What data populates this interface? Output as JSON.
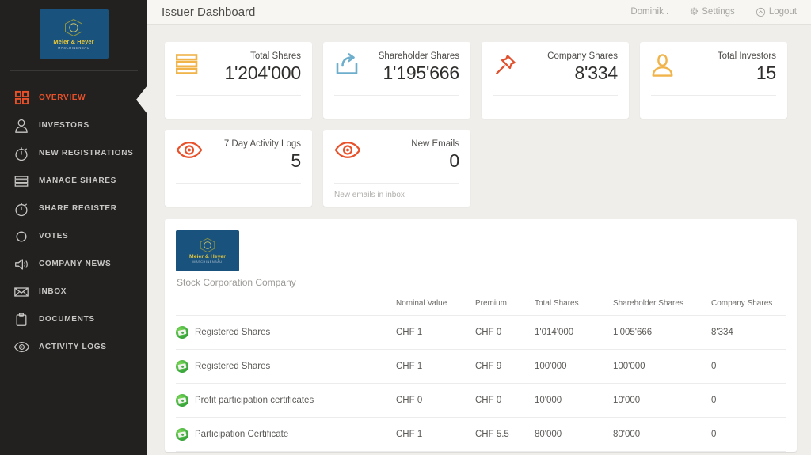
{
  "brand": {
    "name": "Meier & Heyer",
    "subtitle": "MASCHINENBAU",
    "logo_bg": "#19527c",
    "logo_text_color": "#e8c83c"
  },
  "sidebar": {
    "accent": "#e8512a",
    "bg": "#222120",
    "items": [
      {
        "label": "OVERVIEW",
        "icon": "grid-icon",
        "active": true
      },
      {
        "label": "INVESTORS",
        "icon": "user-icon",
        "active": false
      },
      {
        "label": "NEW REGISTRATIONS",
        "icon": "stopwatch-icon",
        "active": false
      },
      {
        "label": "MANAGE SHARES",
        "icon": "stack-icon",
        "active": false
      },
      {
        "label": "SHARE REGISTER",
        "icon": "stopwatch-icon",
        "active": false
      },
      {
        "label": "VOTES",
        "icon": "circle-icon",
        "active": false
      },
      {
        "label": "COMPANY NEWS",
        "icon": "megaphone-icon",
        "active": false
      },
      {
        "label": "INBOX",
        "icon": "envelope-icon",
        "active": false
      },
      {
        "label": "DOCUMENTS",
        "icon": "clipboard-icon",
        "active": false
      },
      {
        "label": "ACTIVITY LOGS",
        "icon": "eye-icon",
        "active": false
      }
    ]
  },
  "topbar": {
    "title": "Issuer Dashboard",
    "user": "Dominik .",
    "settings": "Settings",
    "logout": "Logout"
  },
  "cards": [
    {
      "label": "Total Shares",
      "value": "1'204'000",
      "icon": "bars-icon",
      "color": "#f0b44a",
      "footer": ""
    },
    {
      "label": "Shareholder Shares",
      "value": "1'195'666",
      "icon": "share-icon",
      "color": "#6eaecd",
      "footer": ""
    },
    {
      "label": "Company Shares",
      "value": "8'334",
      "icon": "pin-icon",
      "color": "#e0522f",
      "footer": ""
    },
    {
      "label": "Total Investors",
      "value": "15",
      "icon": "person-icon",
      "color": "#f0b44a",
      "footer": ""
    },
    {
      "label": "7 Day Activity Logs",
      "value": "5",
      "icon": "eye-icon",
      "color": "#e8512a",
      "footer": ""
    },
    {
      "label": "New Emails",
      "value": "0",
      "icon": "eye-icon",
      "color": "#e8512a",
      "footer": "New emails in inbox"
    }
  ],
  "panel": {
    "company_type": "Stock Corporation Company",
    "table": {
      "headers": [
        "",
        "Nominal Value",
        "Premium",
        "Total Shares",
        "Shareholder Shares",
        "Company Shares"
      ],
      "rows": [
        {
          "icon": "money-badge-icon",
          "name": "Registered Shares",
          "nominal_value": "CHF 1",
          "premium": "CHF 0",
          "total_shares": "1'014'000",
          "shareholder_shares": "1'005'666",
          "company_shares": "8'334"
        },
        {
          "icon": "money-badge-icon",
          "name": "Registered Shares",
          "nominal_value": "CHF 1",
          "premium": "CHF 9",
          "total_shares": "100'000",
          "shareholder_shares": "100'000",
          "company_shares": "0"
        },
        {
          "icon": "money-badge-icon",
          "name": "Profit participation certificates",
          "nominal_value": "CHF 0",
          "premium": "CHF 0",
          "total_shares": "10'000",
          "shareholder_shares": "10'000",
          "company_shares": "0"
        },
        {
          "icon": "money-badge-icon",
          "name": "Participation Certificate",
          "nominal_value": "CHF 1",
          "premium": "CHF 5.5",
          "total_shares": "80'000",
          "shareholder_shares": "80'000",
          "company_shares": "0"
        }
      ]
    }
  }
}
